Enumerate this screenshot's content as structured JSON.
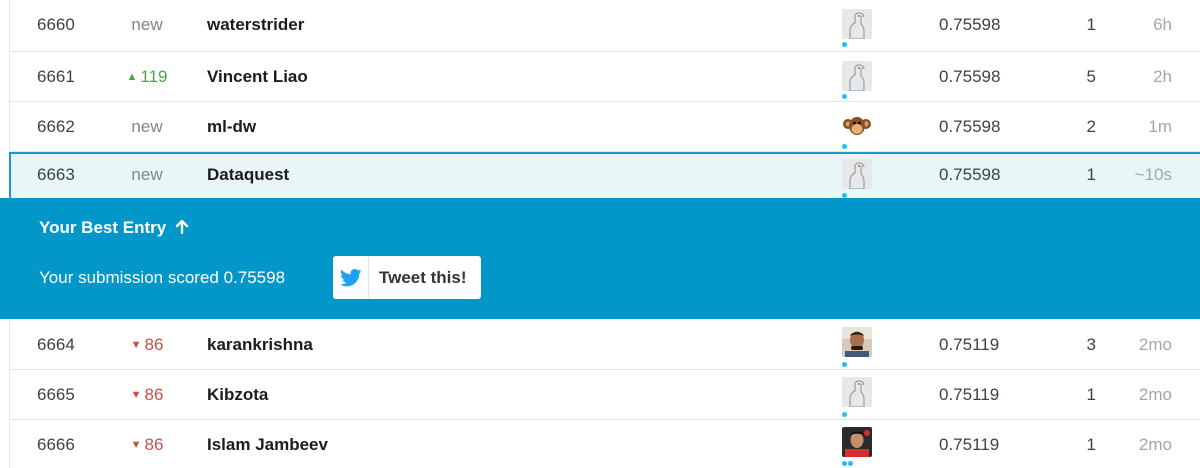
{
  "leaderboard": {
    "rows_top": [
      {
        "rank": "6660",
        "delta": "new",
        "team": "waterstrider",
        "score": "0.75598",
        "entries": "1",
        "last": "6h",
        "avatar": "default-ostrich-avatar"
      },
      {
        "rank": "6661",
        "delta": "119",
        "delta_dir": "up",
        "team": "Vincent Liao",
        "score": "0.75598",
        "entries": "5",
        "last": "2h",
        "avatar": "default-ostrich-avatar"
      },
      {
        "rank": "6662",
        "delta": "new",
        "team": "ml-dw",
        "score": "0.75598",
        "entries": "2",
        "last": "1m",
        "avatar": "monkey-avatar"
      },
      {
        "rank": "6663",
        "delta": "new",
        "team": "Dataquest",
        "score": "0.75598",
        "entries": "1",
        "last": "~10s",
        "avatar": "default-ostrich-avatar"
      }
    ],
    "rows_bottom": [
      {
        "rank": "6664",
        "delta": "86",
        "delta_dir": "down",
        "team": "karankrishna",
        "score": "0.75119",
        "entries": "3",
        "last": "2mo",
        "avatar": "person-photo-avatar"
      },
      {
        "rank": "6665",
        "delta": "86",
        "delta_dir": "down",
        "team": "Kibzota",
        "score": "0.75119",
        "entries": "1",
        "last": "2mo",
        "avatar": "default-ostrich-avatar"
      },
      {
        "rank": "6666",
        "delta": "86",
        "delta_dir": "down",
        "team": "Islam Jambeev",
        "score": "0.75119",
        "entries": "1",
        "last": "2mo",
        "avatar": "person-photo-avatar"
      }
    ]
  },
  "banner": {
    "title": "Your Best Entry",
    "title_icon": "arrow-up-icon",
    "message": "Your submission scored 0.75598",
    "tweet_label": "Tweet this!",
    "tweet_icon": "twitter-bird-icon"
  },
  "colors": {
    "banner_bg": "#0297c9",
    "highlight_row_bg": "#e8f6f7",
    "highlight_border": "#1a9acb",
    "rank_up": "#4aa83f",
    "rank_down": "#c9504a",
    "twitter_blue": "#1da1f2"
  }
}
